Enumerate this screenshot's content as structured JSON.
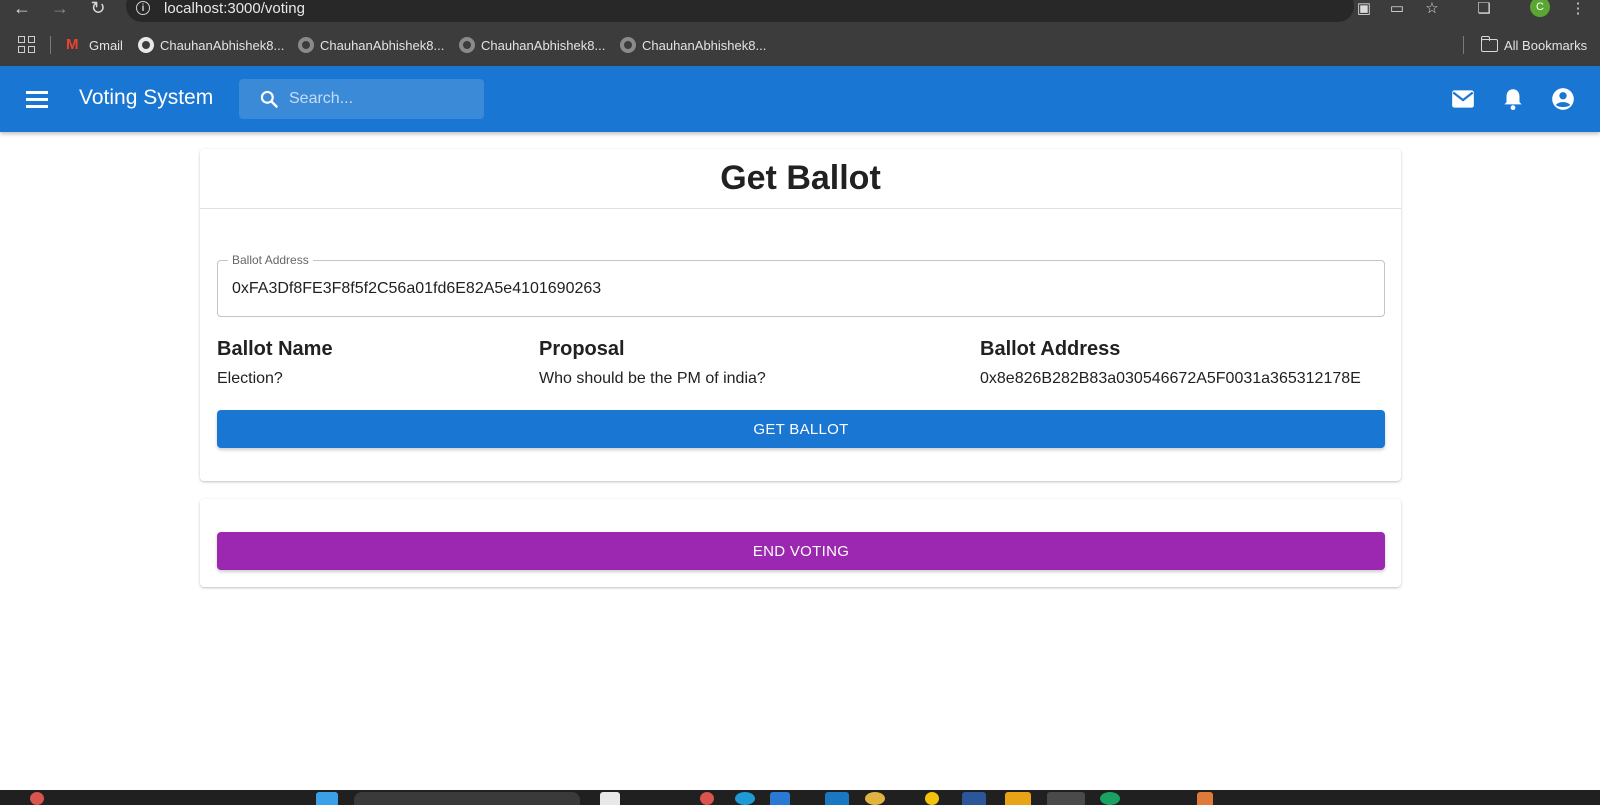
{
  "browser": {
    "url": "localhost:3000/voting",
    "bookmarks": [
      {
        "label": "Gmail",
        "icon": "gmail-icon"
      },
      {
        "label": "ChauhanAbhishek8...",
        "icon": "github-icon"
      },
      {
        "label": "ChauhanAbhishek8...",
        "icon": "github-icon"
      },
      {
        "label": "ChauhanAbhishek8...",
        "icon": "github-icon"
      },
      {
        "label": "ChauhanAbhishek8...",
        "icon": "github-icon"
      }
    ],
    "all_bookmarks_label": "All Bookmarks",
    "profile_initial": "C"
  },
  "appbar": {
    "title": "Voting System",
    "search_placeholder": "Search...",
    "color": "#1976d2"
  },
  "ballot_card": {
    "title": "Get Ballot",
    "address_field": {
      "label": "Ballot Address",
      "value": "0xFA3Df8FE3F8f5f2C56a01fd6E82A5e4101690263"
    },
    "columns": [
      {
        "heading": "Ballot Name",
        "value": "Election?"
      },
      {
        "heading": "Proposal",
        "value": "Who should be the PM of india?"
      },
      {
        "heading": "Ballot Address",
        "value": "0x8e826B282B83a030546672A5F0031a365312178E"
      }
    ],
    "get_button_label": "GET BALLOT"
  },
  "end_card": {
    "end_button_label": "END VOTING",
    "button_color": "#9c27b0"
  }
}
